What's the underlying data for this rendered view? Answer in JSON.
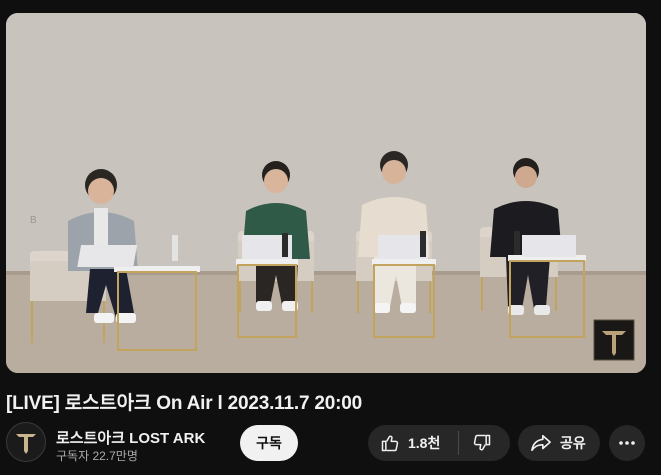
{
  "video": {
    "title": "[LIVE] 로스트아크 On Air l 2023.11.7 20:00",
    "watermark_icon": "lost-ark-logo"
  },
  "channel": {
    "name": "로스트아크 LOST ARK",
    "subscribers": "구독자 22.7만명",
    "avatar_icon": "lost-ark-logo"
  },
  "actions": {
    "subscribe_label": "구독",
    "like_count": "1.8천",
    "share_label": "공유",
    "like_icon": "thumbs-up-icon",
    "dislike_icon": "thumbs-down-icon",
    "share_icon": "share-icon",
    "more_icon": "more-icon"
  },
  "colors": {
    "background": "#0f0f0f",
    "pill": "#272727",
    "subscribe_bg": "#f1f1f1"
  }
}
